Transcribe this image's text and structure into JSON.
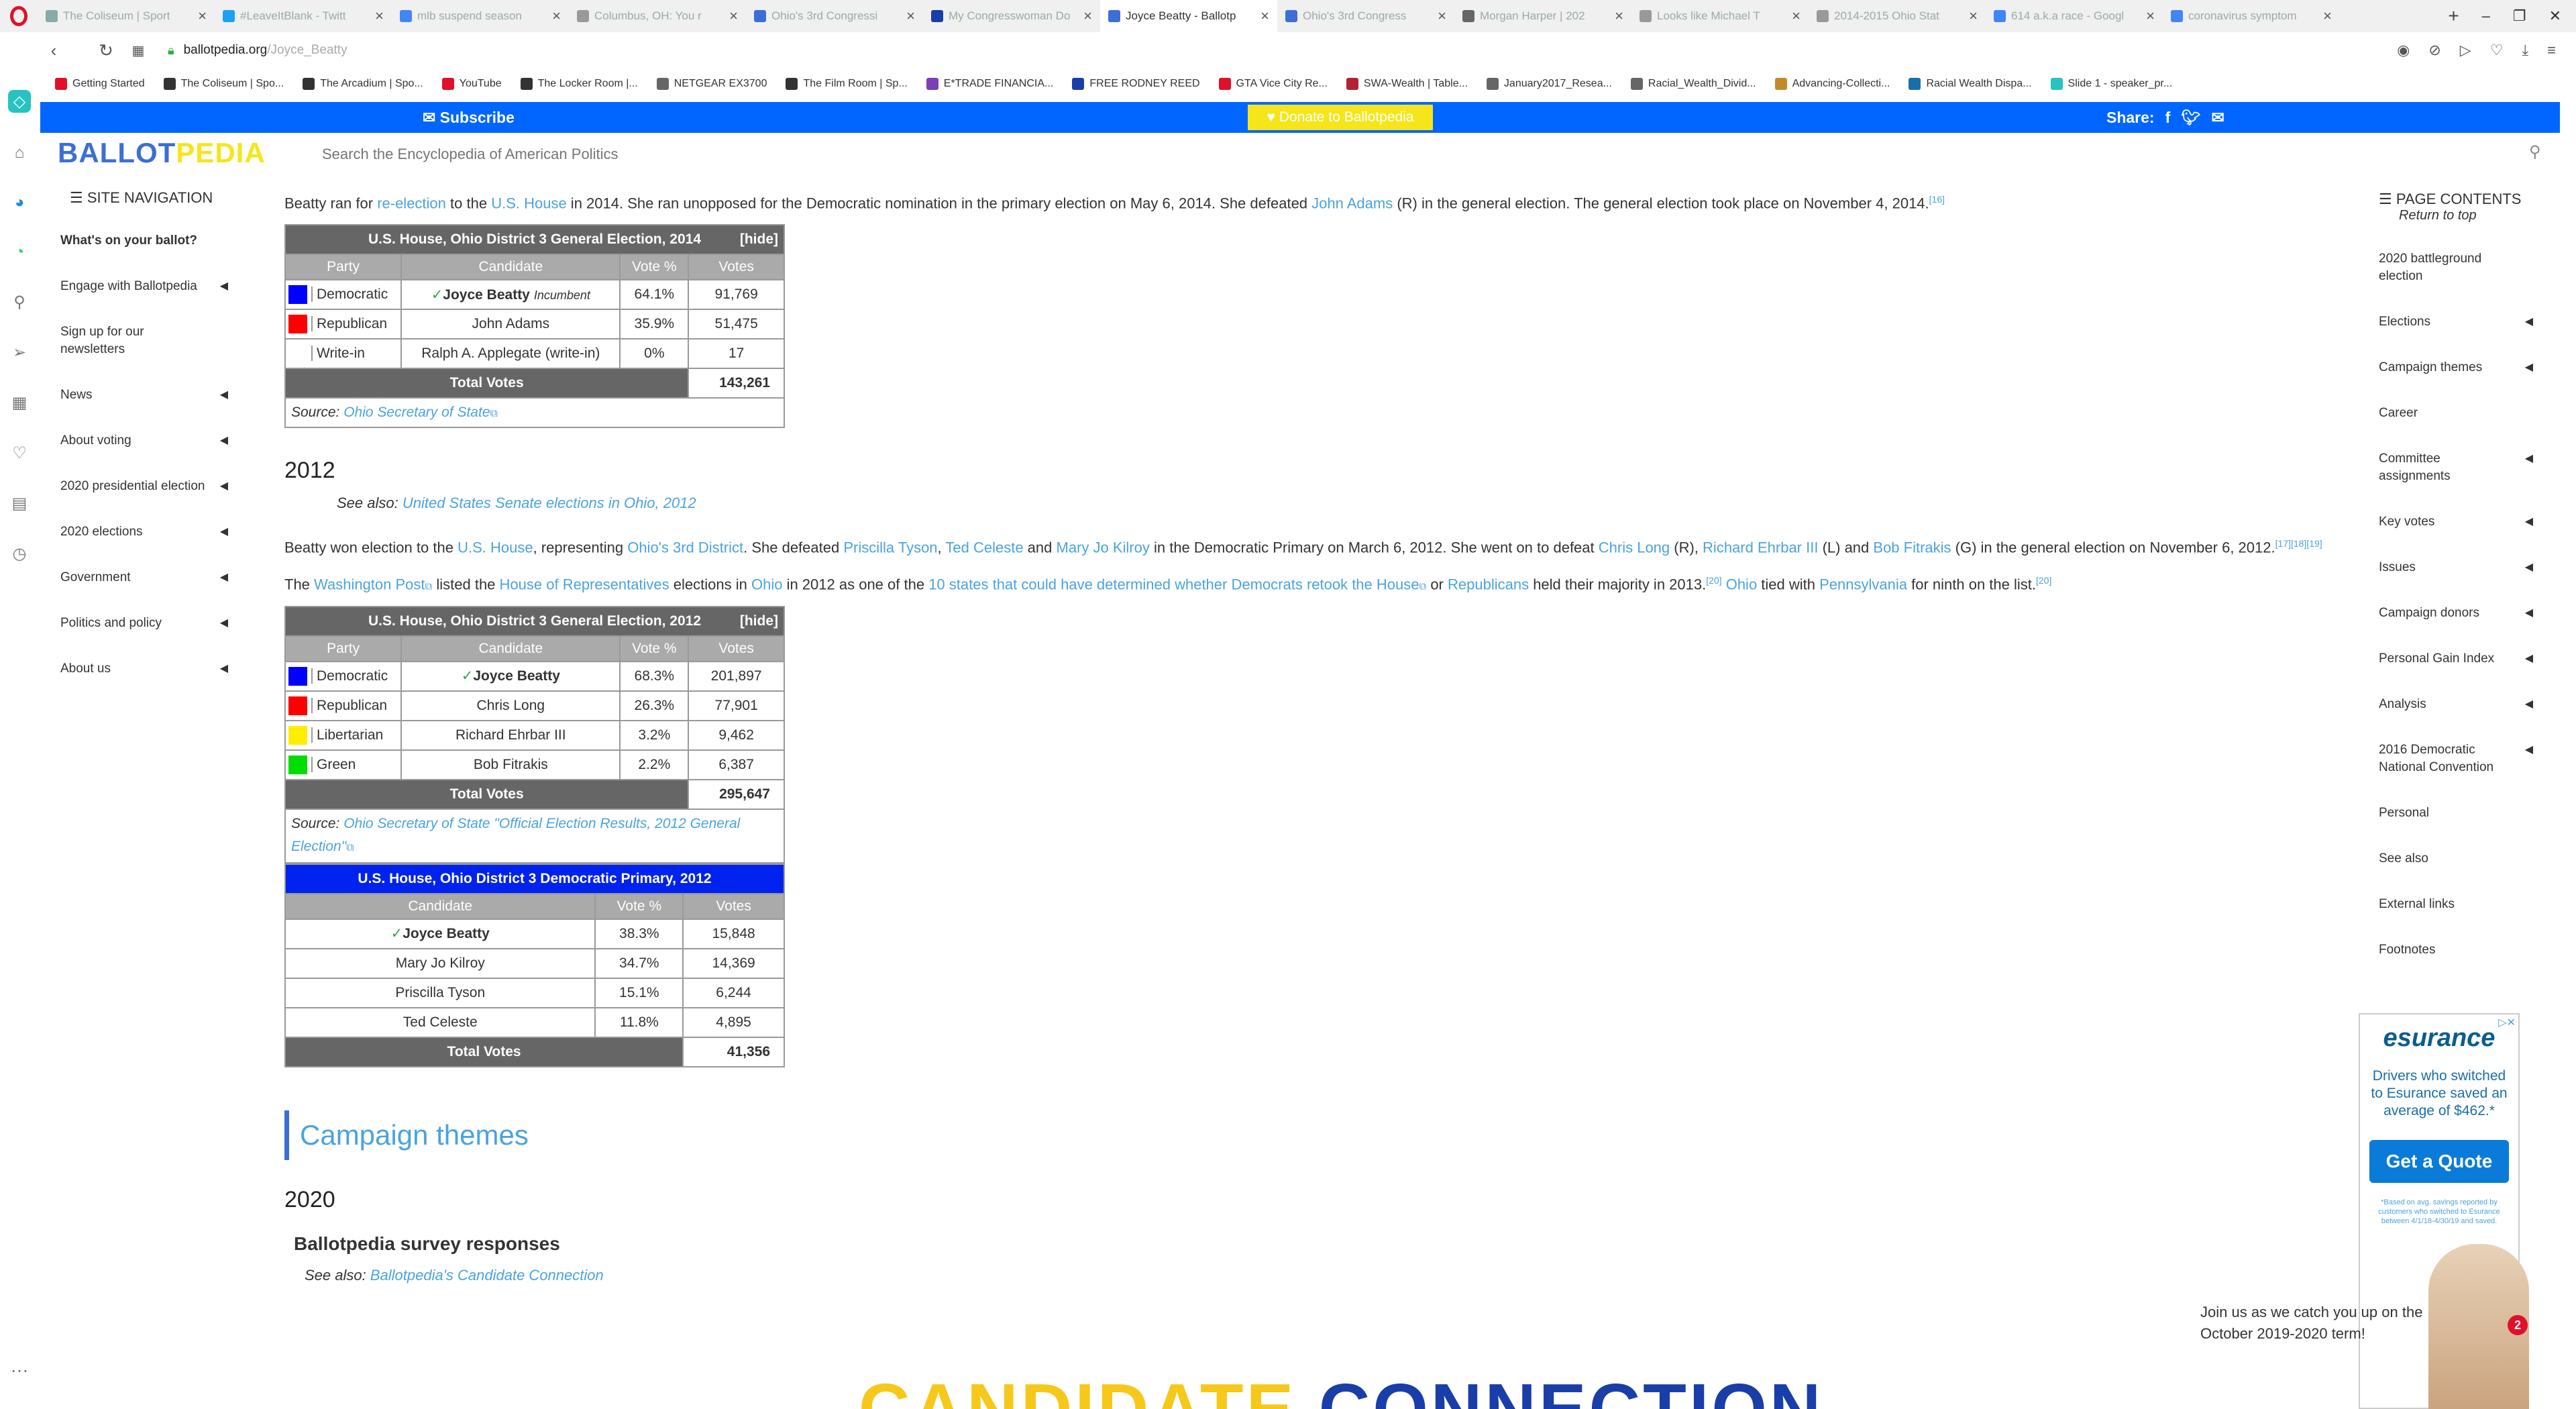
{
  "browser": {
    "tabs": [
      {
        "title": "The Coliseum | Sport",
        "fav": "#8aa"
      },
      {
        "title": "#LeaveItBlank - Twitt",
        "fav": "#1da1f2"
      },
      {
        "title": "mlb suspend season",
        "fav": "#4285f4"
      },
      {
        "title": "Columbus, OH: You r",
        "fav": "#999"
      },
      {
        "title": "Ohio's 3rd Congressi",
        "fav": "#3b6fd6"
      },
      {
        "title": "My Congresswoman Do",
        "fav": "#1a3ea8"
      },
      {
        "title": "Joyce Beatty - Ballotp",
        "fav": "#3b6fd6",
        "active": true
      },
      {
        "title": "Ohio's 3rd Congress",
        "fav": "#3b6fd6"
      },
      {
        "title": "Morgan Harper | 202",
        "fav": "#666"
      },
      {
        "title": "Looks like Michael T",
        "fav": "#999"
      },
      {
        "title": "2014-2015 Ohio Stat",
        "fav": "#999"
      },
      {
        "title": "614 a.k.a race - Googl",
        "fav": "#4285f4"
      },
      {
        "title": "coronavirus symptom",
        "fav": "#4285f4"
      }
    ],
    "url_host": "ballotpedia.org",
    "url_path": "/Joyce_Beatty",
    "bookmarks": [
      {
        "label": "Getting Started",
        "color": "#e0102a"
      },
      {
        "label": "The Coliseum | Spo...",
        "color": "#333"
      },
      {
        "label": "The Arcadium | Spo...",
        "color": "#333"
      },
      {
        "label": "YouTube",
        "color": "#e0102a"
      },
      {
        "label": "The Locker Room |...",
        "color": "#333"
      },
      {
        "label": "NETGEAR EX3700",
        "color": "#666"
      },
      {
        "label": "The Film Room | Sp...",
        "color": "#333"
      },
      {
        "label": "E*TRADE FINANCIA...",
        "color": "#7b3fb6"
      },
      {
        "label": "FREE RODNEY REED",
        "color": "#1a3ea8"
      },
      {
        "label": "GTA Vice City Re...",
        "color": "#e0102a"
      },
      {
        "label": "SWA-Wealth | Table...",
        "color": "#b22234"
      },
      {
        "label": "January2017_Resea...",
        "color": "#666"
      },
      {
        "label": "Racial_Wealth_Divid...",
        "color": "#666"
      },
      {
        "label": "Advancing-Collecti...",
        "color": "#c38a2b"
      },
      {
        "label": "Racial Wealth Dispa...",
        "color": "#1a6ea8"
      },
      {
        "label": "Slide 1 - speaker_pr...",
        "color": "#27c3c3"
      }
    ]
  },
  "banner": {
    "subscribe": "✉ Subscribe",
    "donate": "♥ Donate to Ballotpedia",
    "share": "Share:"
  },
  "header": {
    "logo_a": "BALLOT",
    "logo_b": "PEDIA",
    "search_placeholder": "Search the Encyclopedia of American Politics"
  },
  "sitenav": {
    "title": "☰ SITE NAVIGATION",
    "items": [
      {
        "label": "What's on your ballot?",
        "bold": true,
        "arrow": false
      },
      {
        "label": "Engage with Ballotpedia",
        "arrow": true
      },
      {
        "label": "Sign up for our newsletters",
        "arrow": false
      },
      {
        "label": "News",
        "arrow": true
      },
      {
        "label": "About voting",
        "arrow": true
      },
      {
        "label": "2020 presidential election",
        "arrow": true
      },
      {
        "label": "2020 elections",
        "arrow": true
      },
      {
        "label": "Government",
        "arrow": true
      },
      {
        "label": "Politics and policy",
        "arrow": true
      },
      {
        "label": "About us",
        "arrow": true
      }
    ]
  },
  "toc": {
    "title": "☰ PAGE CONTENTS",
    "return": "Return to top",
    "items": [
      {
        "label": "2020 battleground election",
        "arrow": false
      },
      {
        "label": "Elections",
        "arrow": true
      },
      {
        "label": "Campaign themes",
        "arrow": true
      },
      {
        "label": "Career",
        "arrow": false
      },
      {
        "label": "Committee assignments",
        "arrow": true
      },
      {
        "label": "Key votes",
        "arrow": true
      },
      {
        "label": "Issues",
        "arrow": true
      },
      {
        "label": "Campaign donors",
        "arrow": true
      },
      {
        "label": "Personal Gain Index",
        "arrow": true
      },
      {
        "label": "Analysis",
        "arrow": true
      },
      {
        "label": "2016 Democratic National Convention",
        "arrow": true
      },
      {
        "label": "Personal",
        "arrow": false
      },
      {
        "label": "See also",
        "arrow": false
      },
      {
        "label": "External links",
        "arrow": false
      },
      {
        "label": "Footnotes",
        "arrow": false
      }
    ]
  },
  "content": {
    "p2014": {
      "t1": "Beatty ran for ",
      "l1": "re-election",
      "t2": " to the ",
      "l2": "U.S. House",
      "t3": " in 2014. She ran unopposed for the Democratic nomination in the primary election on May 6, 2014. She defeated ",
      "l3": "John Adams",
      "t4": " (R) in the general election. The general election took place on November 4, 2014.",
      "ref": "[16]"
    },
    "t2014": {
      "title": "U.S. House, Ohio District 3 General Election, 2014",
      "hide": "[hide]",
      "headers": [
        "Party",
        "Candidate",
        "Vote %",
        "Votes"
      ],
      "rows": [
        {
          "party": "Democratic",
          "color": "#0000ff",
          "check": "✓",
          "candidate": "Joyce Beatty",
          "note": "Incumbent",
          "pct": "64.1%",
          "votes": "91,769"
        },
        {
          "party": "Republican",
          "color": "#ff0000",
          "check": "",
          "candidate": "John Adams",
          "note": "",
          "pct": "35.9%",
          "votes": "51,475"
        },
        {
          "party": "Write-in",
          "color": "",
          "check": "",
          "candidate": "Ralph A. Applegate (write-in)",
          "note": "",
          "pct": "0%",
          "votes": "17"
        }
      ],
      "total_label": "Total Votes",
      "total": "143,261",
      "source_label": "Source: ",
      "source_link": "Ohio Secretary of State"
    },
    "h2012": "2012",
    "see2012_label": "See also: ",
    "see2012_link": "United States Senate elections in Ohio, 2012",
    "p2012a": {
      "t1": "Beatty won election to the ",
      "l1": "U.S. House",
      "t2": ", representing ",
      "l2": "Ohio's 3rd District",
      "t3": ". She defeated ",
      "l3": "Priscilla Tyson",
      "t4": ", ",
      "l4": "Ted Celeste",
      "t5": " and ",
      "l5": "Mary Jo Kilroy",
      "t6": " in the Democratic Primary on March 6, 2012. She went on to defeat ",
      "l6": "Chris Long",
      "t7": " (R), ",
      "l7": "Richard Ehrbar III",
      "t8": " (L) and ",
      "l8": "Bob Fitrakis",
      "t9": " (G) in the general election on November 6, 2012.",
      "ref": "[17][18][19]"
    },
    "p2012b": {
      "t1": "The ",
      "l1": "Washington Post",
      "t2": " listed the ",
      "l2": "House of Representatives",
      "t3": " elections in ",
      "l3": "Ohio",
      "t4": " in 2012 as one of the ",
      "l4": "10 states that could have determined whether Democrats retook the House",
      "t5": " or ",
      "l5": "Republicans",
      "t6": " held their majority in 2013.",
      "ref1": "[20]",
      "t7": " ",
      "l6": "Ohio",
      "t8": " tied with ",
      "l7": "Pennsylvania",
      "t9": " for ninth on the list.",
      "ref2": "[20]"
    },
    "t2012": {
      "title": "U.S. House, Ohio District 3 General Election, 2012",
      "hide": "[hide]",
      "headers": [
        "Party",
        "Candidate",
        "Vote %",
        "Votes"
      ],
      "rows": [
        {
          "party": "Democratic",
          "color": "#0000ff",
          "check": "✓",
          "candidate": "Joyce Beatty",
          "pct": "68.3%",
          "votes": "201,897"
        },
        {
          "party": "Republican",
          "color": "#ff0000",
          "check": "",
          "candidate": "Chris Long",
          "pct": "26.3%",
          "votes": "77,901"
        },
        {
          "party": "Libertarian",
          "color": "#ffee00",
          "check": "",
          "candidate": "Richard Ehrbar III",
          "pct": "3.2%",
          "votes": "9,462"
        },
        {
          "party": "Green",
          "color": "#00dd00",
          "check": "",
          "candidate": "Bob Fitrakis",
          "pct": "2.2%",
          "votes": "6,387"
        }
      ],
      "total_label": "Total Votes",
      "total": "295,647",
      "source_label": "Source: ",
      "source_link": "Ohio Secretary of State \"Official Election Results, 2012 General Election\""
    },
    "tprim": {
      "title": "U.S. House, Ohio District 3 Democratic Primary, 2012",
      "headers": [
        "Candidate",
        "Vote %",
        "Votes"
      ],
      "rows": [
        {
          "check": "✓",
          "candidate": "Joyce Beatty",
          "pct": "38.3%",
          "votes": "15,848"
        },
        {
          "check": "",
          "candidate": "Mary Jo Kilroy",
          "pct": "34.7%",
          "votes": "14,369"
        },
        {
          "check": "",
          "candidate": "Priscilla Tyson",
          "pct": "15.1%",
          "votes": "6,244"
        },
        {
          "check": "",
          "candidate": "Ted Celeste",
          "pct": "11.8%",
          "votes": "4,895"
        }
      ],
      "total_label": "Total Votes",
      "total": "41,356"
    },
    "sect_campaign": "Campaign themes",
    "h2020": "2020",
    "h_survey": "Ballotpedia survey responses",
    "see2020_label": "See also: ",
    "see2020_link": "Ballotpedia's Candidate Connection",
    "cc_a": "CANDIDATE",
    "cc_b": " CONNECTION"
  },
  "ad": {
    "brand": "esurance",
    "copy": "Drivers who switched to Esurance saved an average of $462.*",
    "cta": "Get a Quote",
    "fine": "*Based on avg. savings reported by customers who switched to Esurance between 4/1/18-4/30/19 and saved."
  },
  "chat": {
    "text": "Join us as we catch you up on the October 2019-2020 term!",
    "badge": "2"
  }
}
